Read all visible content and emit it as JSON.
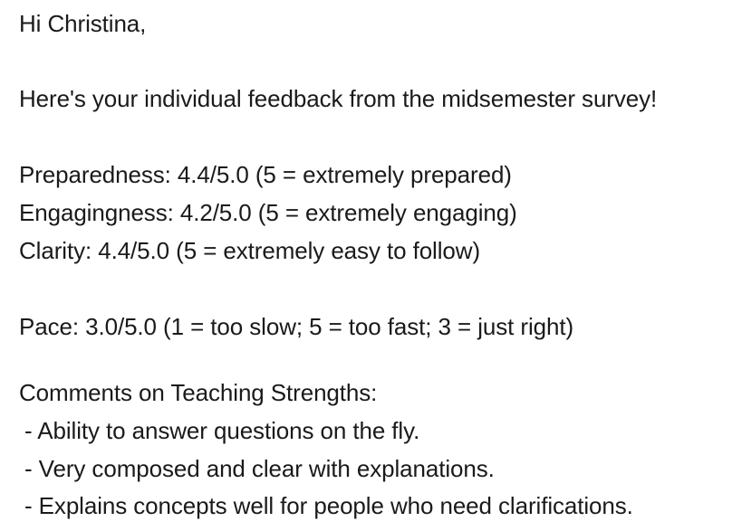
{
  "email": {
    "greeting": "Hi Christina,",
    "intro": "Here's your individual feedback from the midsemester survey!",
    "ratings": [
      "Preparedness: 4.4/5.0 (5 = extremely prepared)",
      "Engagingness: 4.2/5.0 (5 = extremely engaging)",
      "Clarity: 4.4/5.0 (5 = extremely easy to follow)"
    ],
    "pace": "Pace: 3.0/5.0 (1 = too slow; 5 = too fast; 3 = just right)",
    "strengths_heading": "Comments on Teaching Strengths:",
    "strengths": [
      "- Ability to answer questions on the fly.",
      "- Very composed and clear with explanations.",
      "- Explains concepts well for people who need clarifications."
    ]
  }
}
